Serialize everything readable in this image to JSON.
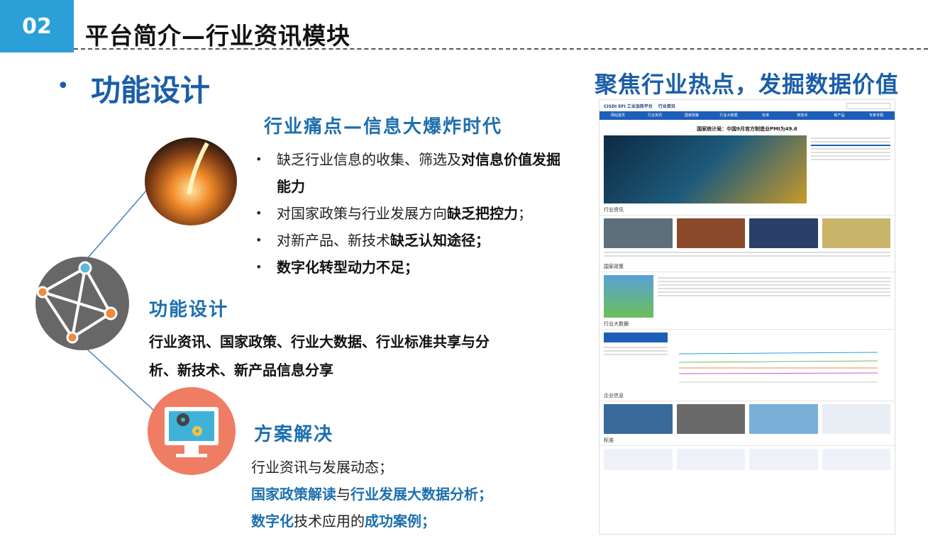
{
  "header": {
    "number": "02",
    "title": "平台简介—行业资讯模块"
  },
  "left": {
    "main_heading": "功能设计",
    "pain_heading": "行业痛点—信息大爆炸时代",
    "pain_items": [
      {
        "normal": "缺乏行业信息的收集、筛选及",
        "strong": "对信息价值发掘能力",
        "tail": ""
      },
      {
        "normal": "对国家政策与行业发展方向",
        "strong": "缺乏把控力",
        "tail": "；"
      },
      {
        "normal": "对新产品、新技术",
        "strong": "缺乏认知途径；",
        "tail": ""
      },
      {
        "normal": "",
        "strong": "数字化转型动力不足；",
        "tail": ""
      }
    ],
    "func_heading": "功能设计",
    "func_text": "行业资讯、国家政策、行业大数据、行业标准共享与分析、新技术、新产品信息分享",
    "sol_heading": "方案解决",
    "sol_line1": "行业资讯与发展动态；",
    "sol_line2_a": "国家政策解读",
    "sol_line2_b": "与",
    "sol_line2_c": "行业发展大数据分析；",
    "sol_line3_a": "数字化",
    "sol_line3_b": "技术应用的",
    "sol_line3_c": "成功案例；"
  },
  "right": {
    "heading": "聚焦行业热点，发掘数据价值",
    "web": {
      "logo": "CISDI EFI 工业加热平台",
      "section": "行业资讯",
      "headline": "国家统计局：中国9月官方制造业PMI为49.6",
      "nav": [
        "网站首页",
        "行业资讯",
        "国家政策",
        "行业大数据",
        "标准",
        "新技术",
        "新产品",
        "专家专题"
      ],
      "sections": [
        "行业资讯",
        "国家政策",
        "行业大数据",
        "企业信息",
        "标准"
      ]
    }
  },
  "colors": {
    "accent": "#2a9fd8",
    "heading_blue": "#1a5ea8"
  }
}
